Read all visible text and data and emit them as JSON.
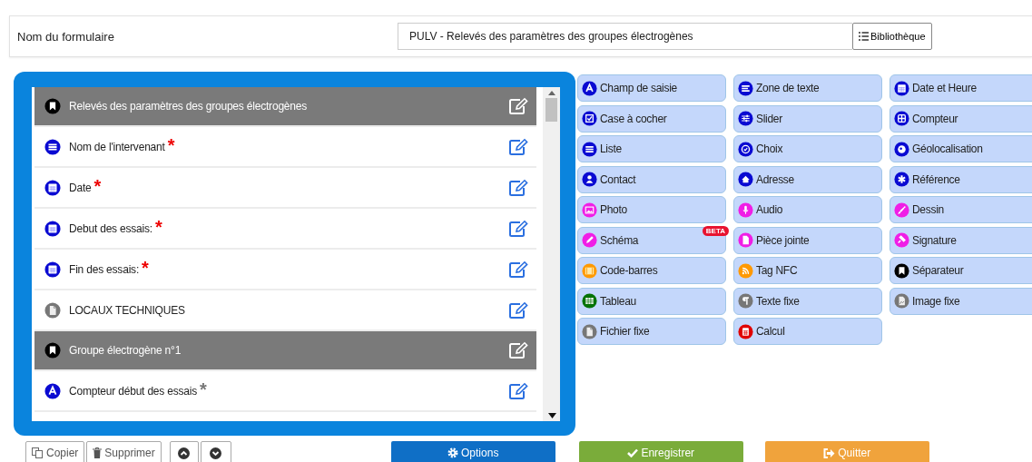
{
  "header": {
    "label": "Nom du formulaire",
    "form_name": "PULV - Relevés des paramètres des groupes électrogènes",
    "library_button": "Bibliothèque"
  },
  "fields": [
    {
      "kind": "section",
      "label": "Relevés des paramètres des groupes électrogènes"
    },
    {
      "kind": "list",
      "label": "Nom de l'intervenant",
      "asterisk": "*",
      "required": true
    },
    {
      "kind": "date",
      "label": "Date",
      "asterisk": "*",
      "required": true
    },
    {
      "kind": "date",
      "label": "Debut des essais:",
      "asterisk": "*",
      "required": true
    },
    {
      "kind": "date",
      "label": "Fin des essais:",
      "asterisk": "*",
      "required": true
    },
    {
      "kind": "file",
      "label": "LOCAUX TECHNIQUES"
    },
    {
      "kind": "section",
      "label": "Groupe électrogène n°1"
    },
    {
      "kind": "text",
      "label": "Compteur début des essais",
      "asterisk": "*",
      "required": false
    }
  ],
  "palette": [
    {
      "kind": "text",
      "label": "Champ de saisie",
      "color": "#0a0ad2"
    },
    {
      "kind": "textarea",
      "label": "Zone de texte",
      "color": "#0a0ad2"
    },
    {
      "kind": "datetime",
      "label": "Date et Heure",
      "color": "#0a0ad2"
    },
    {
      "kind": "checkbox",
      "label": "Case à cocher",
      "color": "#0a0ad2"
    },
    {
      "kind": "slider",
      "label": "Slider",
      "color": "#0a0ad2"
    },
    {
      "kind": "counter",
      "label": "Compteur",
      "color": "#0a0ad2"
    },
    {
      "kind": "list",
      "label": "Liste",
      "color": "#0a0ad2"
    },
    {
      "kind": "choice",
      "label": "Choix",
      "color": "#0a0ad2"
    },
    {
      "kind": "geo",
      "label": "Géolocalisation",
      "color": "#0a0ad2"
    },
    {
      "kind": "contact",
      "label": "Contact",
      "color": "#0a0ad2"
    },
    {
      "kind": "address",
      "label": "Adresse",
      "color": "#0a0ad2"
    },
    {
      "kind": "reference",
      "label": "Référence",
      "color": "#0a0ad2"
    },
    {
      "kind": "photo",
      "label": "Photo",
      "color": "#f01ee6"
    },
    {
      "kind": "audio",
      "label": "Audio",
      "color": "#f01ee6"
    },
    {
      "kind": "drawing",
      "label": "Dessin",
      "color": "#f01ee6"
    },
    {
      "kind": "schema",
      "label": "Schéma",
      "color": "#f01ee6",
      "badge": "BETA"
    },
    {
      "kind": "attachment",
      "label": "Pièce jointe",
      "color": "#f01ee6"
    },
    {
      "kind": "signature",
      "label": "Signature",
      "color": "#f01ee6"
    },
    {
      "kind": "barcode",
      "label": "Code-barres",
      "color": "#ff9900"
    },
    {
      "kind": "nfc",
      "label": "Tag NFC",
      "color": "#ff9900"
    },
    {
      "kind": "separator",
      "label": "Séparateur",
      "color": "#000000"
    },
    {
      "kind": "table",
      "label": "Tableau",
      "color": "#067306"
    },
    {
      "kind": "fixedtext",
      "label": "Texte fixe",
      "color": "#777777"
    },
    {
      "kind": "fixedimage",
      "label": "Image fixe",
      "color": "#777777"
    },
    {
      "kind": "fixedfile",
      "label": "Fichier fixe",
      "color": "#777777"
    },
    {
      "kind": "calc",
      "label": "Calcul",
      "color": "#e00000"
    }
  ],
  "actions": {
    "copy": "Copier",
    "delete": "Supprimer",
    "options": "Options",
    "save": "Enregistrer",
    "quit": "Quitter"
  }
}
